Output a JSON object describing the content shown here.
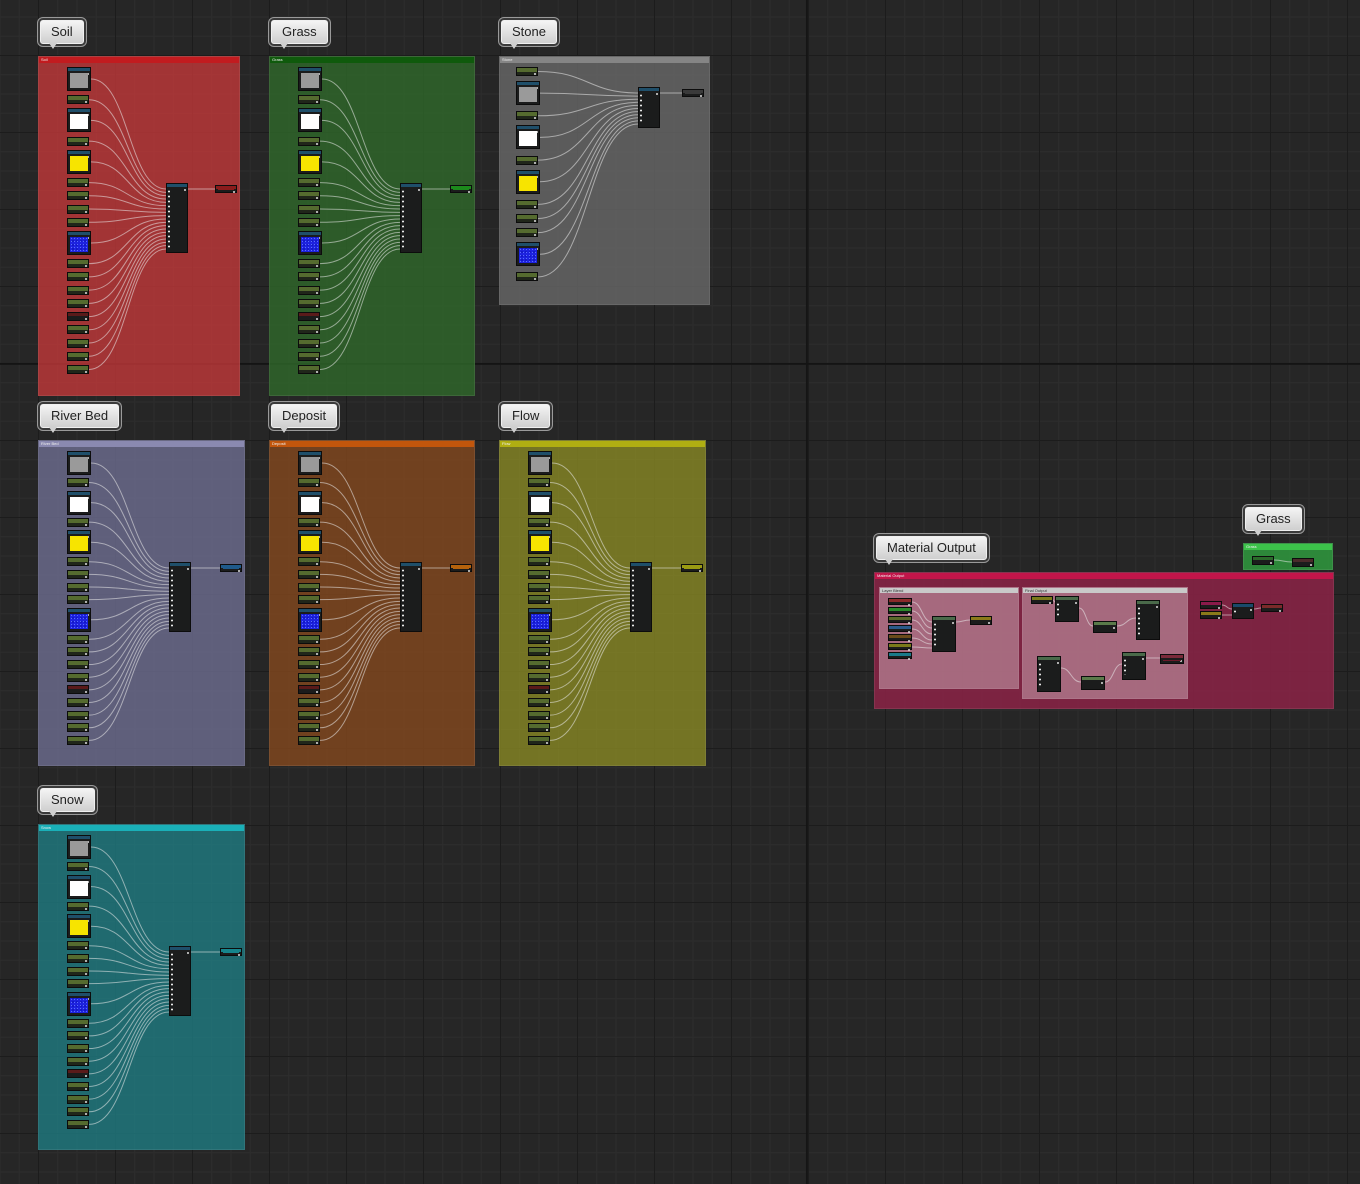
{
  "editor": {
    "type": "material-graph",
    "grid_color": "#262626"
  },
  "groups": [
    {
      "key": "soil",
      "label": "Soil",
      "bar_label": "Soil",
      "color": "#c5383a",
      "bar_color": "#c21b1f",
      "accent": "#8a1c1c",
      "layout": [
        [
          "tex",
          "gray"
        ],
        [
          "param"
        ],
        [
          "tex",
          "white"
        ],
        [
          "param"
        ],
        [
          "tex",
          "yellow"
        ],
        [
          "param"
        ],
        [
          "param"
        ],
        [
          "param"
        ],
        [
          "param"
        ],
        [
          "tex",
          "noise"
        ],
        [
          "param"
        ],
        [
          "param"
        ],
        [
          "param"
        ],
        [
          "param"
        ],
        [
          "param",
          "red"
        ],
        [
          "param"
        ],
        [
          "param"
        ],
        [
          "param"
        ],
        [
          "param"
        ]
      ]
    },
    {
      "key": "grass",
      "label": "Grass",
      "bar_label": "Grass",
      "color": "#2f6a2a",
      "bar_color": "#0f5a0c",
      "accent": "#1c8a1c",
      "layout": [
        [
          "tex",
          "gray"
        ],
        [
          "param"
        ],
        [
          "tex",
          "white"
        ],
        [
          "param"
        ],
        [
          "tex",
          "yellow"
        ],
        [
          "param"
        ],
        [
          "param"
        ],
        [
          "param"
        ],
        [
          "param"
        ],
        [
          "tex",
          "noise"
        ],
        [
          "param"
        ],
        [
          "param"
        ],
        [
          "param"
        ],
        [
          "param"
        ],
        [
          "param",
          "red"
        ],
        [
          "param"
        ],
        [
          "param"
        ],
        [
          "param"
        ],
        [
          "param"
        ]
      ]
    },
    {
      "key": "stone",
      "label": "Stone",
      "bar_label": "Stone",
      "color": "#6a6a6a",
      "bar_color": "#858585",
      "accent": "#3a3a3a",
      "layout": [
        [
          "param"
        ],
        [
          "tex",
          "gray"
        ],
        [
          "param"
        ],
        [
          "tex",
          "white"
        ],
        [
          "param"
        ],
        [
          "tex",
          "yellow"
        ],
        [
          "param"
        ],
        [
          "param"
        ],
        [
          "param"
        ],
        [
          "tex",
          "noise"
        ],
        [
          "param"
        ]
      ]
    },
    {
      "key": "river-bed",
      "label": "River Bed",
      "bar_label": "River Bed",
      "color": "#706f93",
      "bar_color": "#8a89b0",
      "accent": "#1f5a8a",
      "layout": [
        [
          "tex",
          "gray"
        ],
        [
          "param"
        ],
        [
          "tex",
          "white"
        ],
        [
          "param"
        ],
        [
          "tex",
          "yellow"
        ],
        [
          "param"
        ],
        [
          "param"
        ],
        [
          "param"
        ],
        [
          "param"
        ],
        [
          "tex",
          "noise"
        ],
        [
          "param"
        ],
        [
          "param"
        ],
        [
          "param"
        ],
        [
          "param"
        ],
        [
          "param",
          "red"
        ],
        [
          "param"
        ],
        [
          "param"
        ],
        [
          "param"
        ],
        [
          "param"
        ]
      ]
    },
    {
      "key": "deposit",
      "label": "Deposit",
      "bar_label": "Deposit",
      "color": "#87491d",
      "bar_color": "#c2560c",
      "accent": "#b5620c",
      "layout": [
        [
          "tex",
          "gray"
        ],
        [
          "param"
        ],
        [
          "tex",
          "white"
        ],
        [
          "param"
        ],
        [
          "tex",
          "yellow"
        ],
        [
          "param"
        ],
        [
          "param"
        ],
        [
          "param"
        ],
        [
          "param"
        ],
        [
          "tex",
          "noise"
        ],
        [
          "param"
        ],
        [
          "param"
        ],
        [
          "param"
        ],
        [
          "param"
        ],
        [
          "param",
          "red"
        ],
        [
          "param"
        ],
        [
          "param"
        ],
        [
          "param"
        ],
        [
          "param"
        ]
      ]
    },
    {
      "key": "flow",
      "label": "Flow",
      "bar_label": "Flow",
      "color": "#8b8a24",
      "bar_color": "#b0ae12",
      "accent": "#9a9a12",
      "layout": [
        [
          "tex",
          "gray"
        ],
        [
          "param"
        ],
        [
          "tex",
          "white"
        ],
        [
          "param"
        ],
        [
          "tex",
          "yellow"
        ],
        [
          "param"
        ],
        [
          "param"
        ],
        [
          "param"
        ],
        [
          "param"
        ],
        [
          "tex",
          "noise"
        ],
        [
          "param"
        ],
        [
          "param"
        ],
        [
          "param"
        ],
        [
          "param"
        ],
        [
          "param",
          "red"
        ],
        [
          "param"
        ],
        [
          "param"
        ],
        [
          "param"
        ],
        [
          "param"
        ]
      ]
    },
    {
      "key": "snow",
      "label": "Snow",
      "bar_label": "Snow",
      "color": "#1f7d84",
      "bar_color": "#1ab0b8",
      "accent": "#16858c",
      "layout": [
        [
          "tex",
          "gray"
        ],
        [
          "param"
        ],
        [
          "tex",
          "white"
        ],
        [
          "param"
        ],
        [
          "tex",
          "yellow"
        ],
        [
          "param"
        ],
        [
          "param"
        ],
        [
          "param"
        ],
        [
          "param"
        ],
        [
          "tex",
          "noise"
        ],
        [
          "param"
        ],
        [
          "param"
        ],
        [
          "param"
        ],
        [
          "param"
        ],
        [
          "param",
          "red"
        ],
        [
          "param"
        ],
        [
          "param"
        ],
        [
          "param"
        ],
        [
          "param"
        ]
      ]
    }
  ],
  "material_output": {
    "label": "Material Output",
    "bar_label": "Material Output",
    "color": "#8c2346",
    "bar_color": "#c2154a",
    "sub_left_label": "Layer Blend",
    "sub_right_label": "Final Output"
  },
  "grass_small": {
    "label": "Grass",
    "bar_label": "Grass",
    "color": "#2f9a3e",
    "bar_color": "#3cc24a"
  }
}
